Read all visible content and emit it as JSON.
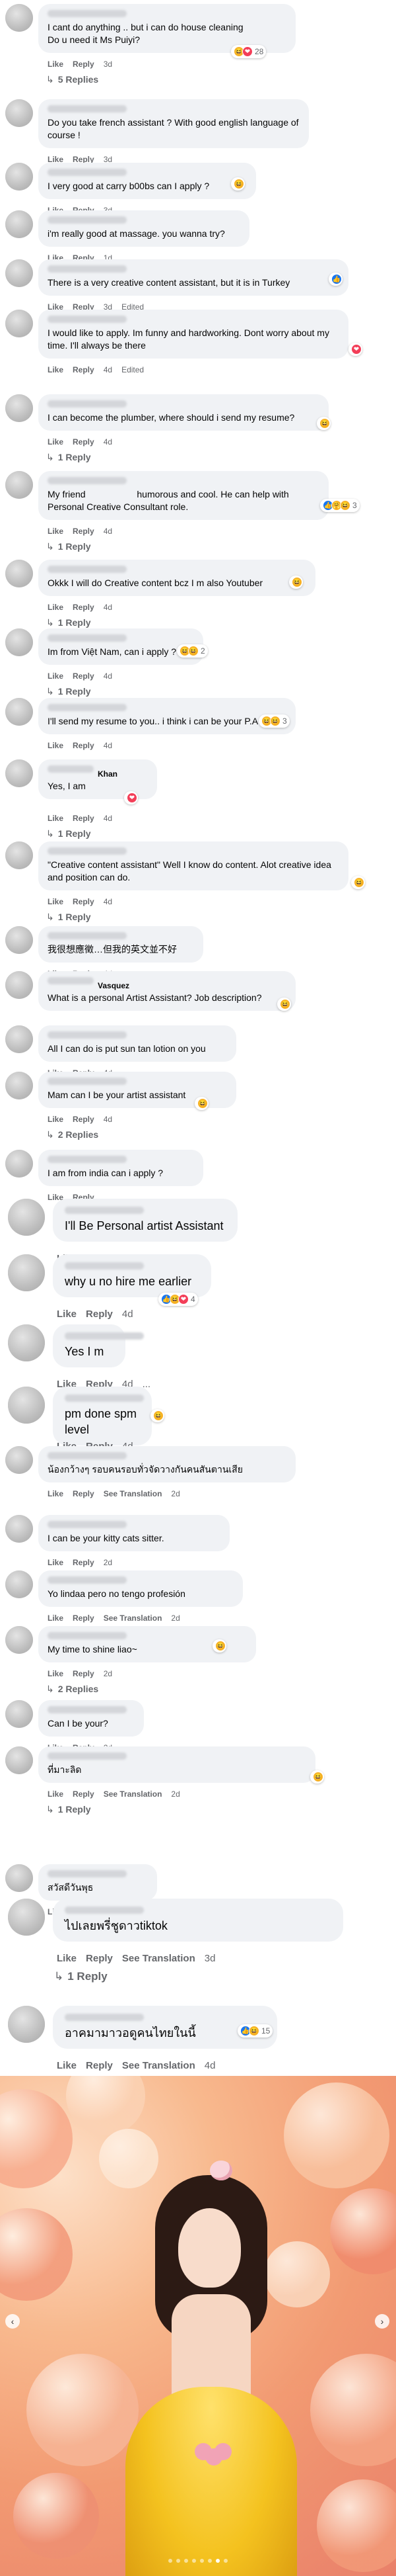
{
  "labels": {
    "like": "Like",
    "reply": "Reply",
    "see_translation": "See Translation",
    "edited": "Edited"
  },
  "comments": [
    {
      "text": "I cant do anything .. but i can do house cleaning\nDo u need it Ms Puiyi?",
      "time": "3d",
      "reactions": [
        "haha",
        "love"
      ],
      "react_count": "28",
      "replies": "5 Replies"
    },
    {
      "text": "Do you take french assistant ? With good english language of course !",
      "time": "3d"
    },
    {
      "text": "I very good at carry b00bs can I apply ?",
      "time": "3d",
      "reactions": [
        "haha"
      ]
    },
    {
      "text": "i'm really good at massage. you wanna try?",
      "time": "1d"
    },
    {
      "text": "There is a very creative content assistant, but it is in Turkey",
      "time": "3d",
      "reactions": [
        "like"
      ]
    },
    {
      "text": "I would like to apply. Im funny and hardworking. Dont worry about my time. I'll always be there",
      "time": "4d",
      "reactions": [
        "love"
      ]
    },
    {
      "text": "I can become the plumber, where should i send my resume?",
      "time": "4d",
      "reactions": [
        "haha"
      ],
      "replies": "1 Reply"
    },
    {
      "text": "My friend                    humorous and cool. He can help with Personal Creative Consultant role.",
      "time": "4d",
      "reactions": [
        "like",
        "care",
        "haha"
      ],
      "react_count": "3",
      "replies": "1 Reply"
    },
    {
      "text": "Okkk I will do Creative content bcz I m also Youtuber",
      "time": "4d",
      "reactions": [
        "haha"
      ],
      "replies": "1 Reply"
    },
    {
      "text": "Im from Việt Nam, can i apply ?",
      "time": "4d",
      "reactions": [
        "haha",
        "haha"
      ],
      "react_count": "2",
      "replies": "1 Reply"
    },
    {
      "text": "I'll send my resume to you.. i think i can be your P.A ..",
      "time": "4d",
      "reactions": [
        "haha",
        "haha"
      ],
      "react_count": "3"
    },
    {
      "name": "Khan",
      "text": "Yes, I am",
      "time": "4d",
      "reactions": [
        "love"
      ],
      "replies": "1 Reply"
    },
    {
      "text": "\"Creative content assistant\" Well I know do content. Alot creative idea and position can do.",
      "time": "4d",
      "reactions": [
        "haha"
      ],
      "replies": "1 Reply"
    },
    {
      "text": "我很想應徵…但我的英文並不好",
      "time": "4d"
    },
    {
      "name": "Vasquez",
      "text": "What is a personal Artist Assistant? Job description?",
      "time": "4d",
      "reactions": [
        "haha"
      ]
    },
    {
      "text": "All I can do is put sun tan lotion on you",
      "time": "4d"
    },
    {
      "text": "Mam can I be your artist assistant",
      "time": "4d",
      "reactions": [
        "haha"
      ],
      "replies": "2 Replies"
    },
    {
      "text": "I am from india can i apply ?"
    },
    {
      "text": "I'll Be Personal artist Assistant",
      "time": "4d"
    },
    {
      "text": "why u no hire me earlier",
      "time": "4d",
      "reactions": [
        "like",
        "haha",
        "love"
      ],
      "react_count": "4"
    },
    {
      "text": "Yes I m",
      "time": "4d",
      "extra": "..."
    },
    {
      "text": "pm done spm level",
      "time": "4d",
      "reactions": [
        "haha"
      ]
    },
    {
      "text": "น้องกว้างๆ รอบคนรอบทั่วจัดวางกันคนสันตานเสีย",
      "time": "2d",
      "translate": true
    },
    {
      "text": "I can be your kitty cats sitter.",
      "time": "2d"
    },
    {
      "text": "Yo lindaa pero no tengo profesión",
      "time": "2d",
      "translate": true
    },
    {
      "text": "My time to shine liao~",
      "time": "2d",
      "reactions": [
        "haha"
      ],
      "replies": "2 Replies"
    },
    {
      "text": "Can I be your?",
      "time": "2d"
    },
    {
      "text": "ที่มาะลิด",
      "time": "2d",
      "translate": true,
      "reactions": [
        "haha"
      ],
      "replies": "1 Reply"
    },
    {
      "text": "สวัสดีวันพุธ",
      "time": "2d",
      "translate": true
    },
    {
      "text": "ไปเลยพรี่ชูดาวtiktok",
      "time": "3d",
      "translate": true,
      "replies": "1 Reply"
    },
    {
      "text": "อาคมามาวอดูคนไทยในนี้",
      "time": "4d",
      "translate": true,
      "reactions": [
        "like",
        "haha"
      ],
      "react_count": "15"
    }
  ],
  "photo": {
    "dots_total": 8,
    "active_dot": 6,
    "prev_icon": "chevron-left-icon",
    "next_icon": "chevron-right-icon"
  }
}
